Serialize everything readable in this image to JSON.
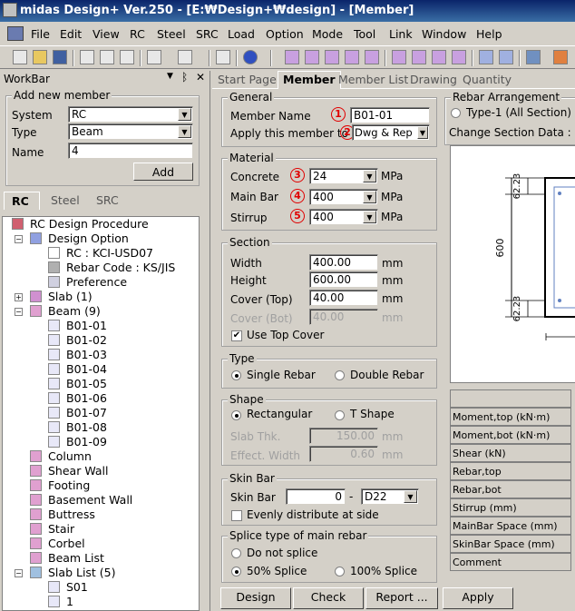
{
  "title": "midas Design+ Ver.250 - [E:₩Design+₩design] - [Member]",
  "menu": [
    "File",
    "Edit",
    "View",
    "RC",
    "Steel",
    "SRC",
    "Load",
    "Option",
    "Mode",
    "Tool",
    "Link",
    "Window",
    "Help"
  ],
  "workbar": {
    "title": "WorkBar",
    "add_group": "Add new member",
    "system_label": "System",
    "system_value": "RC",
    "type_label": "Type",
    "type_value": "Beam",
    "name_label": "Name",
    "name_value": "4",
    "add_button": "Add",
    "tabs": [
      "RC",
      "Steel",
      "SRC"
    ],
    "tree": [
      "RC Design Procedure",
      "Design Option",
      "RC : KCI-USD07",
      "Rebar Code : KS/JIS",
      "Preference",
      "Slab (1)",
      "Beam (9)",
      "B01-01",
      "B01-02",
      "B01-03",
      "B01-04",
      "B01-05",
      "B01-06",
      "B01-07",
      "B01-08",
      "B01-09",
      "Column",
      "Shear Wall",
      "Footing",
      "Basement Wall",
      "Buttress",
      "Stair",
      "Corbel",
      "Beam List",
      "Slab List (5)",
      "S01",
      "1"
    ]
  },
  "doc_tabs": [
    "Start Page",
    "Member",
    "Member List",
    "Drawing",
    "Quantity"
  ],
  "general": {
    "group": "General",
    "member_name_label": "Member Name",
    "member_name_value": "B01-01",
    "apply_label": "Apply this member to",
    "apply_value": "Dwg & Rep"
  },
  "material": {
    "group": "Material",
    "concrete_label": "Concrete",
    "concrete_value": "24",
    "mainbar_label": "Main Bar",
    "mainbar_value": "400",
    "stirrup_label": "Stirrup",
    "stirrup_value": "400",
    "unit": "MPa"
  },
  "section": {
    "group": "Section",
    "width_label": "Width",
    "width_value": "400.00",
    "height_label": "Height",
    "height_value": "600.00",
    "cover_top_label": "Cover (Top)",
    "cover_top_value": "40.00",
    "cover_bot_label": "Cover (Bot)",
    "cover_bot_value": "40.00",
    "unit": "mm",
    "use_top_cover": "Use Top Cover"
  },
  "type": {
    "group": "Type",
    "single": "Single Rebar",
    "double": "Double Rebar"
  },
  "shape": {
    "group": "Shape",
    "rect": "Rectangular",
    "tshape": "T Shape",
    "slab_thk_label": "Slab Thk.",
    "slab_thk_value": "150.00",
    "eff_width_label": "Effect. Width",
    "eff_width_value": "0.60",
    "unit": "mm"
  },
  "skinbar": {
    "group": "Skin Bar",
    "label": "Skin Bar",
    "count": "0",
    "dash": "-",
    "size": "D22",
    "evenly": "Evenly distribute at side"
  },
  "splice": {
    "group": "Splice type of main rebar",
    "none": "Do not splice",
    "p50": "50% Splice",
    "p100": "100% Splice"
  },
  "buttons": {
    "design": "Design",
    "check": "Check",
    "report": "Report ...",
    "apply": "Apply"
  },
  "rebar": {
    "group": "Rebar Arrangement",
    "type1": "Type-1 (All Section)",
    "change_label": "Change Section Data :",
    "dim_top": "62.23",
    "dim_height": "600",
    "dim_bot": "62.23"
  },
  "table_rows": [
    "Moment,top (kN·m)",
    "Moment,bot (kN·m)",
    "Shear (kN)",
    "Rebar,top",
    "Rebar,bot",
    "Stirrup (mm)",
    "MainBar Space (mm)",
    "SkinBar Space (mm)",
    "Comment"
  ],
  "markers": [
    "1",
    "2",
    "3",
    "4",
    "5"
  ]
}
